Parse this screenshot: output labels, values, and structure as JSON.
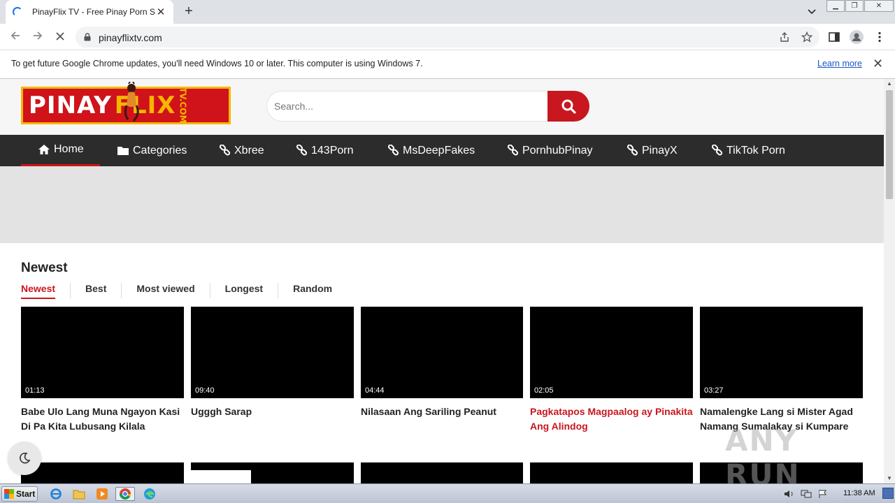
{
  "browser": {
    "tab_title": "PinayFlix TV - Free Pinay Porn Site",
    "url": "pinayflixtv.com",
    "new_tab_symbol": "+",
    "tab_close_symbol": "✕"
  },
  "infobar": {
    "message": "To get future Google Chrome updates, you'll need Windows 10 or later. This computer is using Windows 7.",
    "link": "Learn more",
    "close_symbol": "✕"
  },
  "site": {
    "logo_part1": "PINAY",
    "logo_part2": "FLIX",
    "logo_part3": "TV.COM",
    "search_placeholder": "Search...",
    "nav": [
      {
        "label": "Home",
        "icon": "home-icon"
      },
      {
        "label": "Categories",
        "icon": "folder-icon"
      },
      {
        "label": "Xbree",
        "icon": "link-icon"
      },
      {
        "label": "143Porn",
        "icon": "link-icon"
      },
      {
        "label": "MsDeepFakes",
        "icon": "link-icon"
      },
      {
        "label": "PornhubPinay",
        "icon": "link-icon"
      },
      {
        "label": "PinayX",
        "icon": "link-icon"
      },
      {
        "label": "TikTok Porn",
        "icon": "link-icon"
      }
    ],
    "section_title": "Newest",
    "filters": [
      "Newest",
      "Best",
      "Most viewed",
      "Longest",
      "Random"
    ],
    "videos": [
      {
        "duration": "01:13",
        "title": "Babe Ulo Lang Muna Ngayon Kasi Di Pa Kita Lubusang Kilala"
      },
      {
        "duration": "09:40",
        "title": "Ugggh Sarap"
      },
      {
        "duration": "04:44",
        "title": "Nilasaan Ang Sariling Peanut"
      },
      {
        "duration": "02:05",
        "title": "Pagkatapos Magpaalog ay Pinakita Ang Alindog"
      },
      {
        "duration": "03:27",
        "title": "Namalengke Lang si Mister Agad Namang Sumalakay si Kumpare"
      }
    ],
    "accent_color": "#c8171e",
    "watermark": "ANY RUN"
  },
  "taskbar": {
    "start_label": "Start",
    "clock": "11:38 AM"
  }
}
